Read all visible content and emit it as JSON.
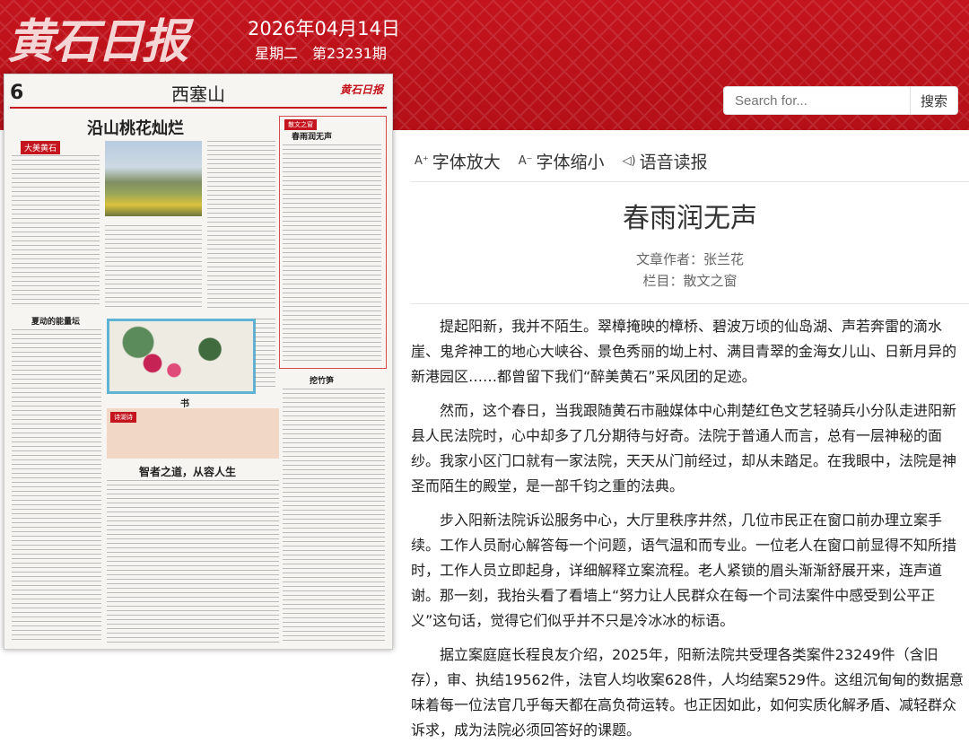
{
  "header": {
    "logo_text": "黄石日报",
    "date": "2026年04月14日",
    "issue": "星期二　第23231期"
  },
  "search": {
    "placeholder": "Search for...",
    "button_label": "搜索"
  },
  "newspaper_page": {
    "page_number": "6",
    "section_name": "西塞山",
    "headline_main": "沿山桃花灿烂",
    "headline_essay": "春雨润无声",
    "headline_2": "夏动的能量坛",
    "headline_3": "挖竹笋",
    "headline_4": "书",
    "headline_5": "智者之道，从容人生",
    "tag_1": "大美黄石",
    "tag_2": "散文之窗",
    "tag_3": "诗湖诗",
    "tag_4": "散文之窗"
  },
  "toolbar": {
    "font_bigger": "字体放大",
    "font_smaller": "字体缩小",
    "voice": "语音读报"
  },
  "article": {
    "title": "春雨润无声",
    "author": "文章作者：张兰花",
    "column": "栏目：散文之窗",
    "paragraphs": [
      "提起阳新，我并不陌生。翠樟掩映的樟桥、碧波万顷的仙岛湖、声若奔雷的滴水崖、鬼斧神工的地心大峡谷、景色秀丽的坳上村、满目青翠的金海女儿山、日新月异的新港园区……都曾留下我们“醉美黄石”采风团的足迹。",
      "然而，这个春日，当我跟随黄石市融媒体中心荆楚红色文艺轻骑兵小分队走进阳新县人民法院时，心中却多了几分期待与好奇。法院于普通人而言，总有一层神秘的面纱。我家小区门口就有一家法院，天天从门前经过，却从未踏足。在我眼中，法院是神圣而陌生的殿堂，是一部千钧之重的法典。",
      "步入阳新法院诉讼服务中心，大厅里秩序井然，几位市民正在窗口前办理立案手续。工作人员耐心解答每一个问题，语气温和而专业。一位老人在窗口前显得不知所措时，工作人员立即起身，详细解释立案流程。老人紧锁的眉头渐渐舒展开来，连声道谢。那一刻，我抬头看了看墙上“努力让人民群众在每一个司法案件中感受到公平正义”这句话，觉得它们似乎并不只是冷冰冰的标语。",
      "据立案庭庭长程良友介绍，2025年，阳新法院共受理各类案件23249件（含旧存），审、执结19562件，法官人均收案628件，人均结案529件。这组沉甸甸的数据意味着每一位法官几乎每天都在高负荷运转。也正因如此，如何实质化解矛盾、减轻群众诉求，成为法院必须回答好的课题。"
    ]
  }
}
